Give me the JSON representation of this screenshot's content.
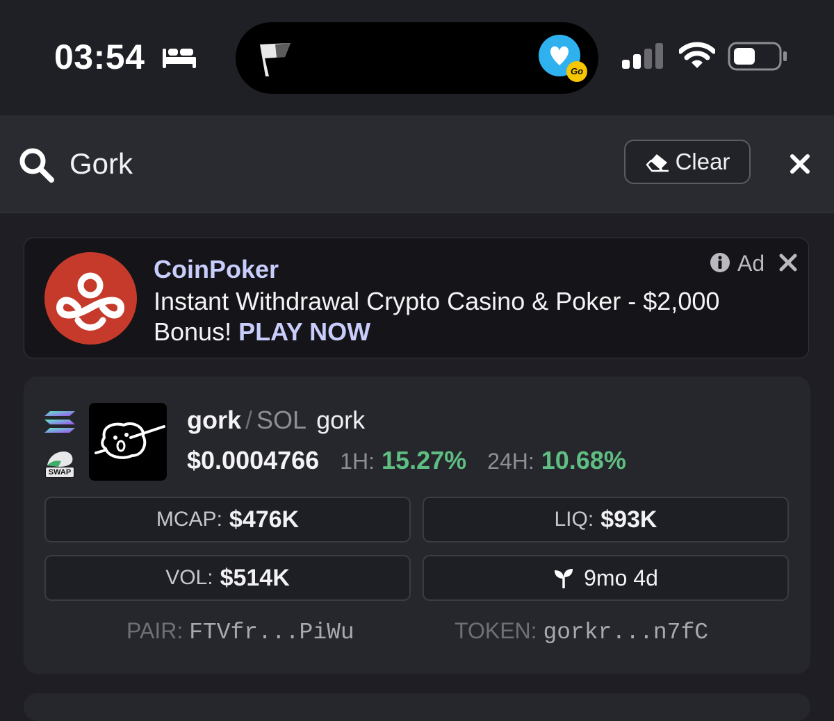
{
  "status_bar": {
    "time": "03:54",
    "icons": [
      "bed-icon",
      "flag-icon",
      "vimeo-go-app-icon",
      "cellular-signal-icon",
      "wifi-icon",
      "battery-icon"
    ],
    "vimeo_badge": "Go"
  },
  "search": {
    "query": "Gork",
    "clear_label": "Clear"
  },
  "ad": {
    "title": "CoinPoker",
    "text": "Instant Withdrawal Crypto Casino & Poker - $2,000 Bonus!",
    "cta": "PLAY NOW",
    "label": "Ad",
    "logo_color": "#c63a2b"
  },
  "token": {
    "base_symbol": "gork",
    "separator": "/",
    "quote_symbol": "SOL",
    "name": "gork",
    "price": "$0.0004766",
    "change_1h_label": "1H:",
    "change_1h": "15.27%",
    "change_24h_label": "24H:",
    "change_24h": "10.68%",
    "positive_color": "#5fbe82",
    "chain_icon": "solana-icon",
    "dex_icon": "swap-icon",
    "dex_badge": "SWAP",
    "stats": {
      "mcap_label": "MCAP:",
      "mcap": "$476K",
      "liq_label": "LIQ:",
      "liq": "$93K",
      "vol_label": "VOL:",
      "vol": "$514K",
      "age": "9mo 4d"
    },
    "pair_label": "PAIR:",
    "pair_address": "FTVfr...PiWu",
    "token_label": "TOKEN:",
    "token_address": "gorkr...n7fC"
  }
}
